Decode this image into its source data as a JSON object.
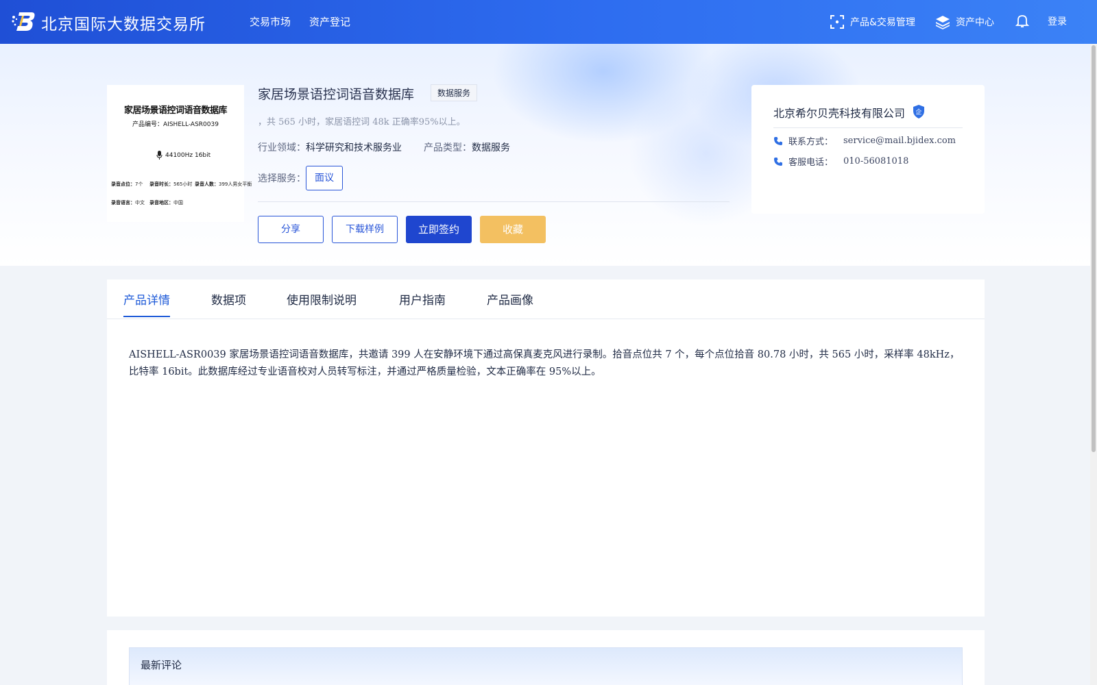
{
  "header": {
    "site_title": "北京国际大数据交易所",
    "nav": [
      {
        "label": "交易市场"
      },
      {
        "label": "资产登记"
      }
    ],
    "right": {
      "product_mgmt": "产品&交易管理",
      "asset_center": "资产中心",
      "login": "登录"
    },
    "colors": {
      "bar_start": "#1f4fd6",
      "bar_end": "#3b82f6"
    }
  },
  "cover": {
    "title": "家居场景语控词语音数据库",
    "code": "产品编号：AISHELL-ASR0039",
    "audio": "44100Hz 16bit",
    "meta": [
      {
        "label": "录音点位：",
        "value": "7个"
      },
      {
        "label": "录音时长：",
        "value": "565小时"
      },
      {
        "label": "录音人数：",
        "value": "399人男女平衡"
      },
      {
        "label": "录音语言：",
        "value": "中文"
      },
      {
        "label": "录音地区：",
        "value": "中国"
      }
    ]
  },
  "product": {
    "title": "家居场景语控词语音数据库",
    "tag": "数据服务",
    "subdesc": "，共 565 小时，家居语控词 48k 正确率95%以上。",
    "industry_label": "行业领域：",
    "industry_value": "科学研究和技术服务业",
    "type_label": "产品类型：",
    "type_value": "数据服务",
    "select_label": "选择服务：",
    "select_option": "面议",
    "buttons": {
      "share": "分享",
      "download": "下载样例",
      "sign": "立即签约",
      "favorite": "收藏"
    },
    "colors": {
      "primary": "#1f46cf",
      "favorite": "#f3c061"
    }
  },
  "company": {
    "name": "北京希尔贝壳科技有限公司",
    "badge": "企",
    "contact_label": "联系方式：",
    "contact_value": "service@mail.bjidex.com",
    "phone_label": "客服电话：",
    "phone_value": "010-56081018"
  },
  "tabs": [
    {
      "label": "产品详情",
      "active": true
    },
    {
      "label": "数据项",
      "active": false
    },
    {
      "label": "使用限制说明",
      "active": false
    },
    {
      "label": "用户指南",
      "active": false
    },
    {
      "label": "产品画像",
      "active": false
    }
  ],
  "detail": {
    "text": "AISHELL-ASR0039 家居场景语控词语音数据库，共邀请 399 人在安静环境下通过高保真麦克风进行录制。拾音点位共 7 个，每个点位拾音 80.78 小时，共 565 小时，采样率 48kHz，比特率 16bit。此数据库经过专业语音校对人员转写标注，并通过严格质量检验，文本正确率在 95%以上。"
  },
  "comments": {
    "title": "最新评论"
  }
}
